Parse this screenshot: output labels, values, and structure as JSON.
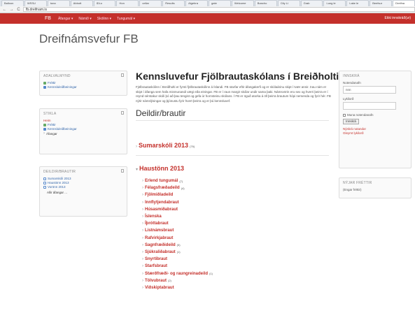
{
  "browser": {
    "tabs": [
      "Balloon",
      "WSSU",
      "tuna",
      "Abbott",
      "IDLo",
      "Hon",
      "cellar",
      "Results",
      "Algebra",
      "gate",
      "Welcome",
      "Bancho",
      "City Li",
      "Grab",
      "Lung le",
      "Lake le",
      "Beefsur",
      "Dreifna"
    ],
    "url": "fb.dreifnam.is",
    "back": "←",
    "forward": "→",
    "reload": "C"
  },
  "navbar": {
    "brand": "FB",
    "menus": [
      "Áfangar ▾",
      "Námið ▾",
      "Skólinn ▾",
      "Tungumál ▾"
    ],
    "login_status": "Ekki innskráð(ur)"
  },
  "site_title": "Dreifnámsvefur FB",
  "blocks": {
    "admin": {
      "title": "ADALVALMYND",
      "items": [
        "Fréttir",
        "Kennsluleiðbeiningar"
      ]
    },
    "navigation": {
      "title": "STIKLA",
      "items": [
        "Heim",
        "Fréttir",
        "Kennsluleiðbeiningar",
        "Áfangar"
      ]
    },
    "categories": {
      "title": "DEILDIR/BRAUTIR",
      "items": [
        "Sumarskóli 2013",
        "Haustönn 2013",
        "Vorönn 2013"
      ],
      "more": "Allir áfangar ..."
    },
    "login": {
      "title": "INNSKRÁ",
      "username_label": "Notendanafn",
      "username_value": "nnn",
      "password_label": "Lykilorð",
      "remember_label": "Muna notendanafn",
      "button": "Innskrá",
      "link_new": "Nýskrá notanda!",
      "link_forgot": "Gleymt lykilorð"
    },
    "news": {
      "title": "NÝJAR FRÉTTIR",
      "text": "(Engar fréttir)"
    }
  },
  "main": {
    "title": "Kennsluvefur Fjölbrautaskólans í Breiðholti",
    "intro": "Fjölbrautaskólinn í Breiðholti er fyrsti fjölbrautaskólinn á Íslandi. FB starfar eftir áfangakerfi og er skólaárinu skipt í tvær annir. Þau nám er skipt í áfanga sem hafa mismunandi vægi eða einingar. FB er í raun margir skólar undir sama þaki. Námsvörin eru sex og hverri þeirra er í reynd sérstakur skóli þó að þau tengist og gefa úr hornsteinu skólans. Í FB er öguð atorka á öll þeirra brautum hópi nemenda og fyrir hér. FB nýtir námslýsingar og þjónustu fyrir hvert þeirra og er þú kennsluvef.",
    "section_title": "Deildir/brautir",
    "cat_summer": "Sumarskóli 2013",
    "cat_summer_count": "(76)",
    "cat_autumn": "Haustönn 2013",
    "subcats": [
      {
        "name": "Erlend tungumál",
        "count": "(7)"
      },
      {
        "name": "Félagsfræðadeild",
        "count": "(4)"
      },
      {
        "name": "Fjölmiðladeild",
        "count": ""
      },
      {
        "name": "Innflytjendabraut",
        "count": ""
      },
      {
        "name": "Húsasmíðabraut",
        "count": ""
      },
      {
        "name": "Íslenska",
        "count": ""
      },
      {
        "name": "Íþróttabraut",
        "count": ""
      },
      {
        "name": "Listnámsbraut",
        "count": ""
      },
      {
        "name": "Rafvirkjabraut",
        "count": ""
      },
      {
        "name": "Sagnfræðideild",
        "count": "(5)"
      },
      {
        "name": "Sjúkraliðabraut",
        "count": "(1)"
      },
      {
        "name": "Snyrtibraut",
        "count": ""
      },
      {
        "name": "Starfsbraut",
        "count": ""
      },
      {
        "name": "Stærðfræði- og raungreinadeild",
        "count": "(1)"
      },
      {
        "name": "Tölvubraut",
        "count": "(2)"
      },
      {
        "name": "Viðskiptabraut",
        "count": ""
      }
    ]
  },
  "colors": {
    "brand_red": "#c4302b",
    "link_blue": "#3366aa"
  }
}
